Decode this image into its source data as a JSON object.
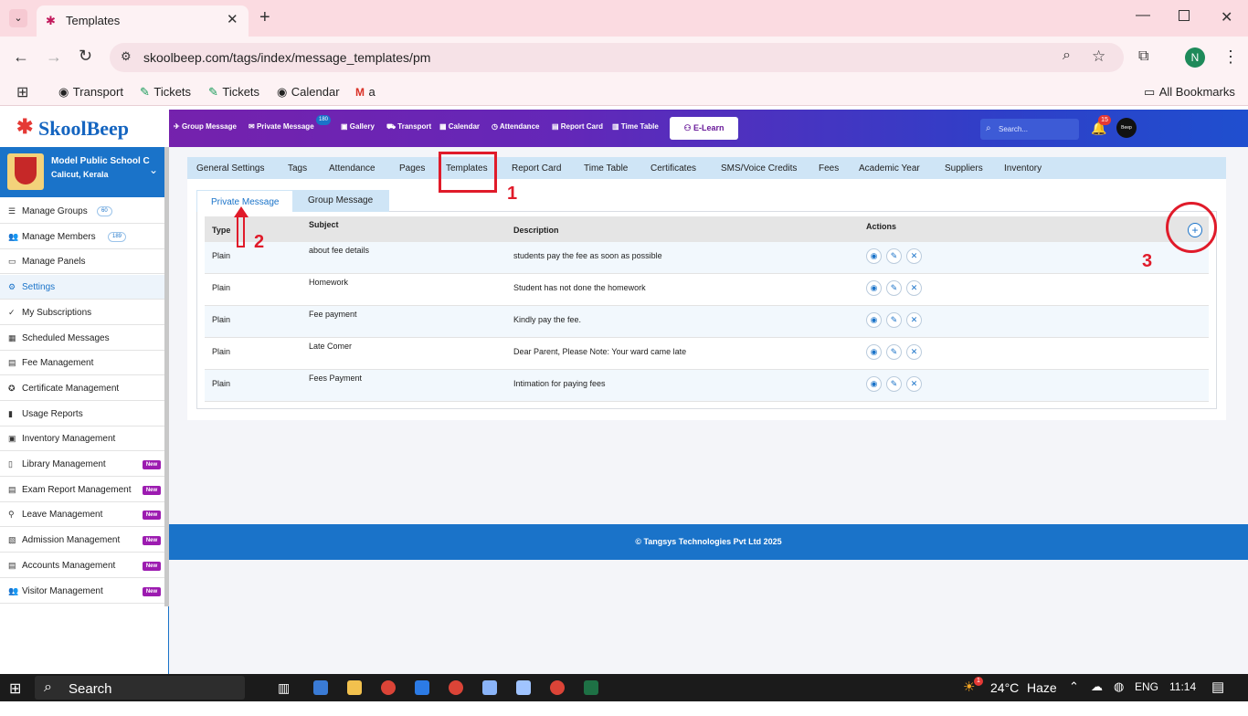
{
  "browser": {
    "tab_title": "Templates",
    "url": "skoolbeep.com/tags/index/message_templates/pm",
    "profile_initial": "N",
    "bookmarks": [
      "Transport",
      "Tickets",
      "Tickets",
      "Calendar",
      "a"
    ],
    "all_bookmarks": "All Bookmarks"
  },
  "app": {
    "logo_text": "SkoolBeep",
    "nav": [
      "Group Message",
      "Private Message",
      "Gallery",
      "Transport",
      "Calendar",
      "Attendance",
      "Report Card",
      "Time Table"
    ],
    "private_badge": "180",
    "elearn": "E-Learn",
    "search_placeholder": "Search...",
    "notif_count": "15",
    "avatar_text": "Beep"
  },
  "school": {
    "name": "Model Public School C",
    "location": "Calicut, Kerala"
  },
  "sidebar": [
    {
      "label": "Manage Groups",
      "badge": "60",
      "icon": "list-icon"
    },
    {
      "label": "Manage Members",
      "badge": "189",
      "icon": "users-icon"
    },
    {
      "label": "Manage Panels",
      "icon": "monitor-icon"
    },
    {
      "label": "Settings",
      "icon": "gear-icon",
      "active": true
    },
    {
      "label": "My Subscriptions",
      "icon": "check-icon"
    },
    {
      "label": "Scheduled Messages",
      "icon": "calendar-icon"
    },
    {
      "label": "Fee Management",
      "icon": "file-icon"
    },
    {
      "label": "Certificate Management",
      "icon": "award-icon"
    },
    {
      "label": "Usage Reports",
      "icon": "bar-chart-icon"
    },
    {
      "label": "Inventory Management",
      "icon": "box-icon"
    },
    {
      "label": "Library Management",
      "icon": "book-icon",
      "new": "New"
    },
    {
      "label": "Exam Report Management",
      "icon": "file-icon",
      "new": "New"
    },
    {
      "label": "Leave Management",
      "icon": "leave-icon",
      "new": "New"
    },
    {
      "label": "Admission Management",
      "icon": "id-card-icon",
      "new": "New"
    },
    {
      "label": "Accounts Management",
      "icon": "file-icon",
      "new": "New"
    },
    {
      "label": "Visitor Management",
      "icon": "users-icon",
      "new": "New"
    }
  ],
  "settings_tabs": [
    "General Settings",
    "Tags",
    "Attendance",
    "Pages",
    "Templates",
    "Report Card",
    "Time Table",
    "Certificates",
    "SMS/Voice Credits",
    "Fees",
    "Academic Year",
    "Suppliers",
    "Inventory"
  ],
  "sub_tabs": [
    "Private Message",
    "Group Message"
  ],
  "table": {
    "headers": [
      "Type",
      "Subject",
      "Description",
      "Actions"
    ],
    "rows": [
      {
        "type": "Plain",
        "subject": "about fee details",
        "description": "students pay the fee as soon as possible"
      },
      {
        "type": "Plain",
        "subject": "Homework",
        "description": "Student has not done the homework"
      },
      {
        "type": "Plain",
        "subject": "Fee payment",
        "description": "Kindly pay the fee."
      },
      {
        "type": "Plain",
        "subject": "Late Comer",
        "description": "Dear Parent, Please Note: Your ward came late"
      },
      {
        "type": "Plain",
        "subject": "Fees Payment",
        "description": "Intimation for paying fees"
      }
    ]
  },
  "footer": "© Tangsys Technologies Pvt Ltd 2025",
  "annotations": [
    "1",
    "2",
    "3"
  ],
  "taskbar": {
    "search": "Search",
    "temp": "24°C",
    "weather": "Haze",
    "lang": "ENG",
    "time": "11:14",
    "weather_badge": "1"
  },
  "colors": {
    "accent": "#1a73c9",
    "annotation": "#e01b2a",
    "new_badge": "#9c1bb0"
  }
}
